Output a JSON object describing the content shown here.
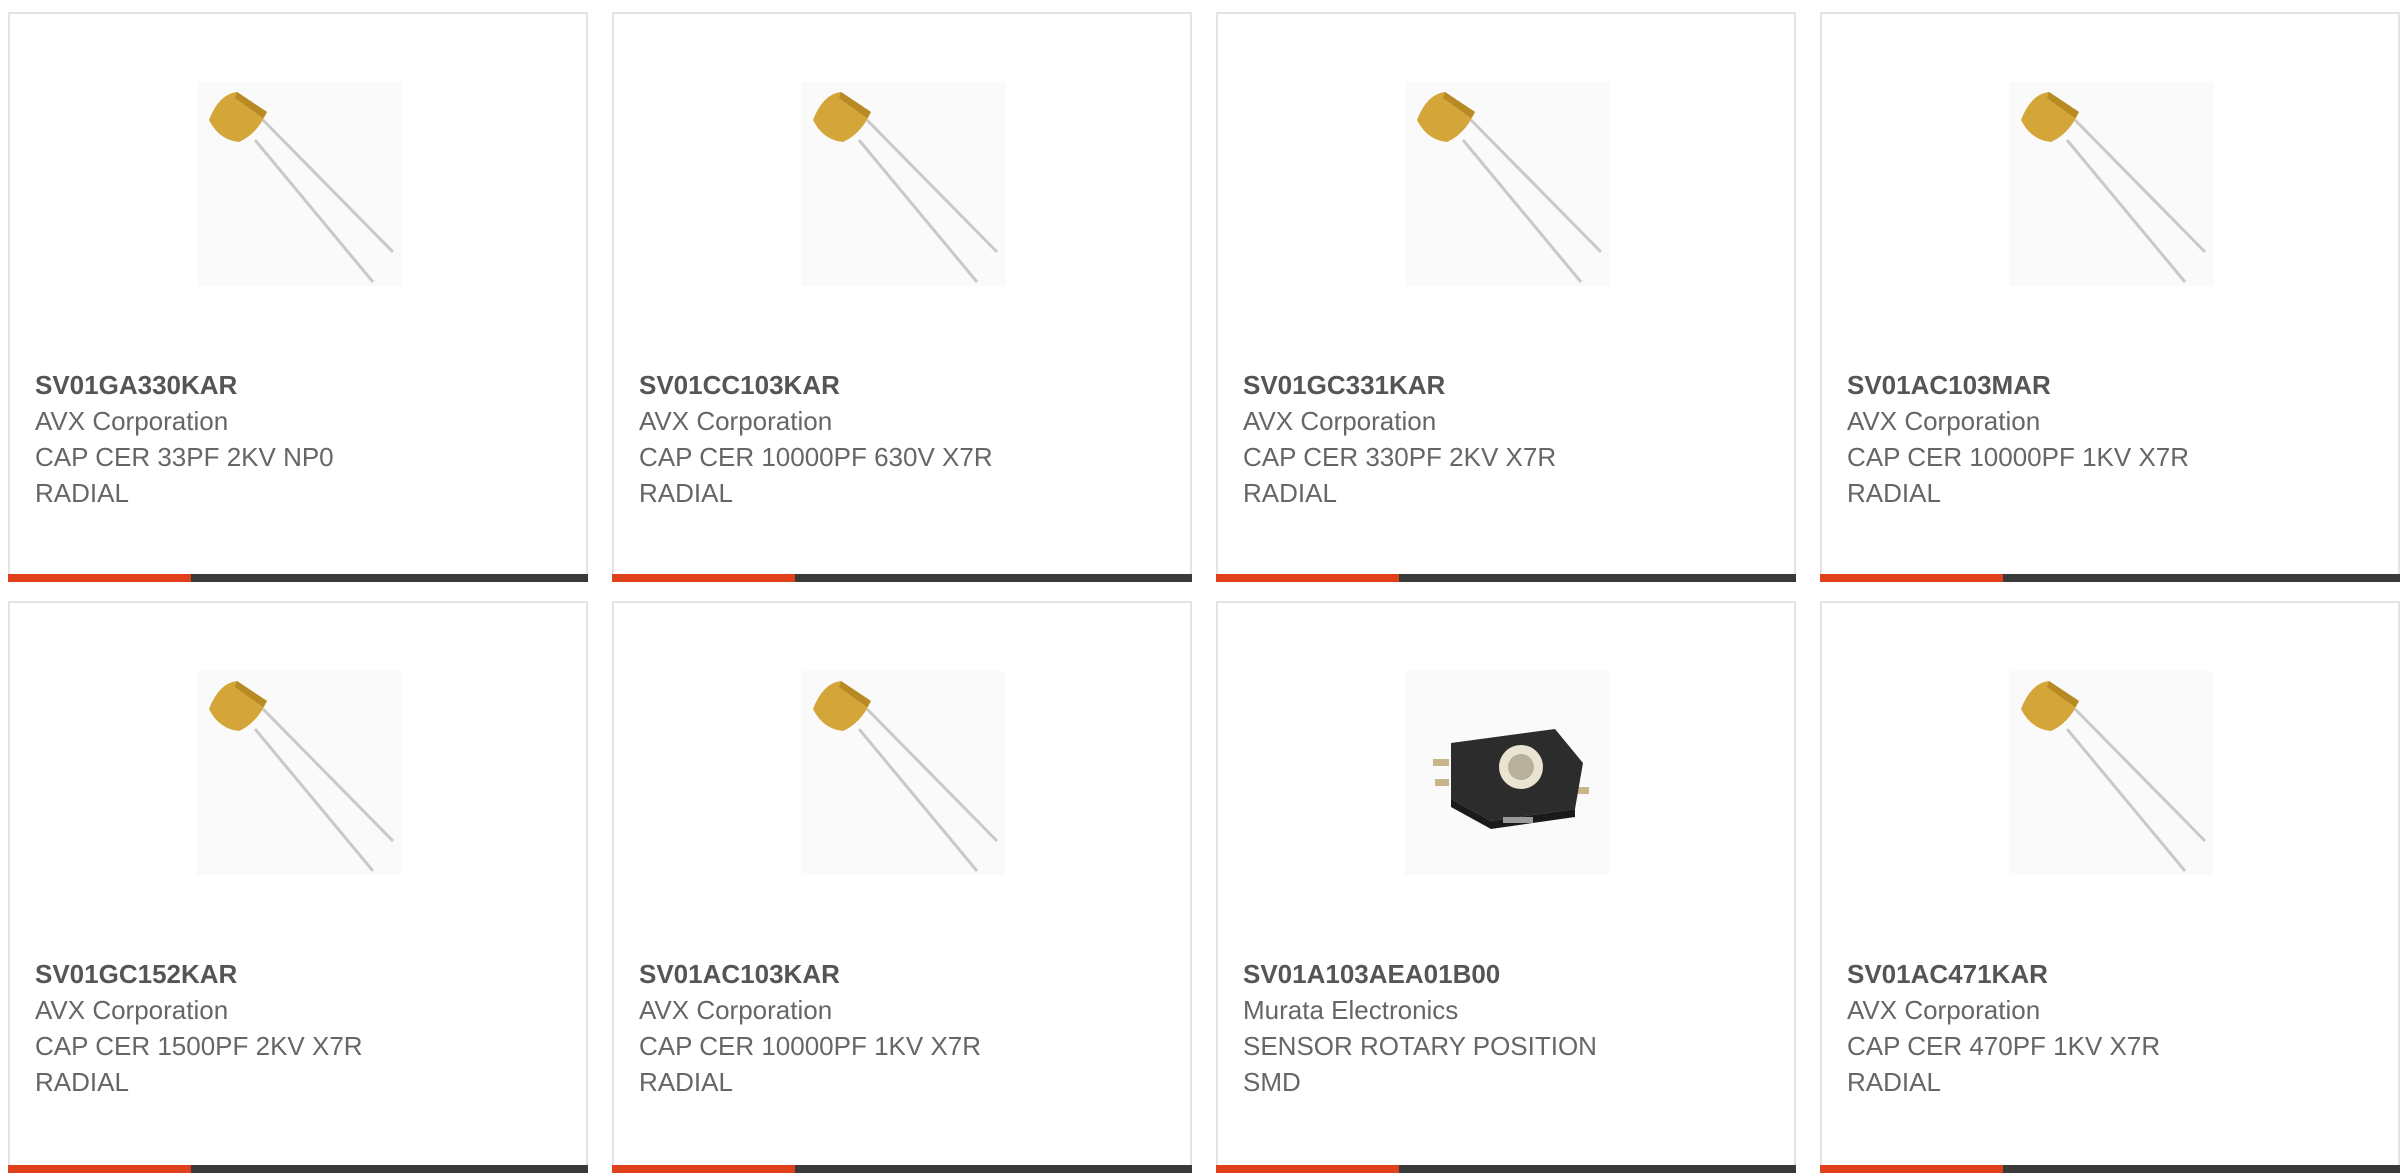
{
  "colors": {
    "accent": "#e0411b",
    "bar_dark": "#3a3a3a",
    "border": "#e3e3e3"
  },
  "products": [
    {
      "part_number": "SV01GA330KAR",
      "manufacturer": "AVX Corporation",
      "description_line1": "CAP CER 33PF 2KV NP0",
      "description_line2": "RADIAL",
      "image": "ceramic-capacitor-radial-icon"
    },
    {
      "part_number": "SV01CC103KAR",
      "manufacturer": "AVX Corporation",
      "description_line1": "CAP CER 10000PF 630V X7R",
      "description_line2": "RADIAL",
      "image": "ceramic-capacitor-radial-icon"
    },
    {
      "part_number": "SV01GC331KAR",
      "manufacturer": "AVX Corporation",
      "description_line1": "CAP CER 330PF 2KV X7R",
      "description_line2": "RADIAL",
      "image": "ceramic-capacitor-radial-icon"
    },
    {
      "part_number": "SV01AC103MAR",
      "manufacturer": "AVX Corporation",
      "description_line1": "CAP CER 10000PF 1KV X7R",
      "description_line2": "RADIAL",
      "image": "ceramic-capacitor-radial-icon"
    },
    {
      "part_number": "SV01GC152KAR",
      "manufacturer": "AVX Corporation",
      "description_line1": "CAP CER 1500PF 2KV X7R",
      "description_line2": "RADIAL",
      "image": "ceramic-capacitor-radial-icon"
    },
    {
      "part_number": "SV01AC103KAR",
      "manufacturer": "AVX Corporation",
      "description_line1": "CAP CER 10000PF 1KV X7R",
      "description_line2": "RADIAL",
      "image": "ceramic-capacitor-radial-icon"
    },
    {
      "part_number": "SV01A103AEA01B00",
      "manufacturer": "Murata Electronics",
      "description_line1": "SENSOR ROTARY POSITION",
      "description_line2": "SMD",
      "image": "rotary-position-sensor-icon"
    },
    {
      "part_number": "SV01AC471KAR",
      "manufacturer": "AVX Corporation",
      "description_line1": "CAP CER 470PF 1KV X7R",
      "description_line2": "RADIAL",
      "image": "ceramic-capacitor-radial-icon"
    }
  ]
}
